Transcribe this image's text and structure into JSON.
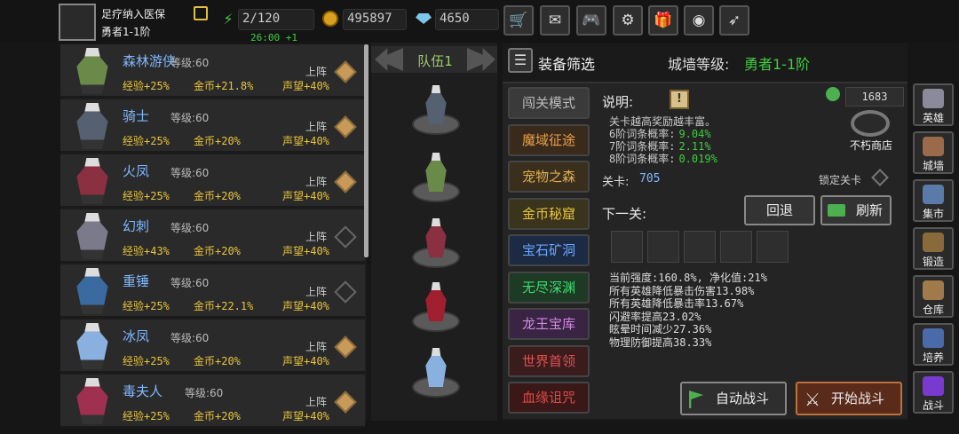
{
  "player": {
    "name": "足疗纳入医保",
    "rank": "勇者1-1阶"
  },
  "resources": {
    "energy": "2/120",
    "energy_timer": "26:00 +1",
    "gold": "495897",
    "gems": "4650"
  },
  "toolbar_icons": [
    "cart-icon",
    "mail-icon",
    "gamepad-icon",
    "gear-icon",
    "gift-icon",
    "wheel-icon",
    "feather-icon"
  ],
  "heroes": [
    {
      "name": "森林游侠",
      "level": "等级:60",
      "action": "上阵",
      "bonus": [
        "经验+25%",
        "金币+21.8%",
        "声望+40%"
      ],
      "deployed": true
    },
    {
      "name": "骑士",
      "level": "等级:60",
      "action": "上阵",
      "bonus": [
        "经验+25%",
        "金币+20%",
        "声望+40%"
      ],
      "deployed": true
    },
    {
      "name": "火凤",
      "level": "等级:60",
      "action": "上阵",
      "bonus": [
        "经验+25%",
        "金币+20%",
        "声望+40%"
      ],
      "deployed": true
    },
    {
      "name": "幻刺",
      "level": "等级:60",
      "action": "上阵",
      "bonus": [
        "经验+43%",
        "金币+20%",
        "声望+40%"
      ],
      "deployed": false
    },
    {
      "name": "重锤",
      "level": "等级:60",
      "action": "上阵",
      "bonus": [
        "经验+25%",
        "金币+22.1%",
        "声望+40%"
      ],
      "deployed": false
    },
    {
      "name": "冰凤",
      "level": "等级:60",
      "action": "上阵",
      "bonus": [
        "经验+25%",
        "金币+20%",
        "声望+40%"
      ],
      "deployed": true
    },
    {
      "name": "毒夫人",
      "level": "等级:60",
      "action": "上阵",
      "bonus": [
        "经验+25%",
        "金币+20%",
        "声望+40%"
      ],
      "deployed": true
    }
  ],
  "team": {
    "label": "队伍1"
  },
  "filter": {
    "label": "装备筛选"
  },
  "wall": {
    "label": "城墙等级:",
    "value": "勇者1-1阶"
  },
  "modes": [
    {
      "label": "闯关模式",
      "color": "#bbbbbb",
      "bg": "#3a3a3a"
    },
    {
      "label": "魔域征途",
      "color": "#e8a04a",
      "bg": "#3a2a1c"
    },
    {
      "label": "宠物之森",
      "color": "#e0b050",
      "bg": "#3a2e1c"
    },
    {
      "label": "金币秘窟",
      "color": "#e8c43c",
      "bg": "#3a341c"
    },
    {
      "label": "宝石矿洞",
      "color": "#6aa8ff",
      "bg": "#1c2a44"
    },
    {
      "label": "无尽深渊",
      "color": "#3fdf6f",
      "bg": "#1c3a24"
    },
    {
      "label": "龙王宝库",
      "color": "#d08ae0",
      "bg": "#3a2444"
    },
    {
      "label": "世界首领",
      "color": "#e05050",
      "bg": "#3a1c1c"
    },
    {
      "label": "血缘诅咒",
      "color": "#e04848",
      "bg": "#3a1818"
    }
  ],
  "description": {
    "label": "说明:",
    "lines": [
      {
        "text": "关卡越高奖励越丰富。",
        "value": ""
      },
      {
        "text": "6阶词条概率:",
        "value": "9.04%"
      },
      {
        "text": "7阶词条概率:",
        "value": "2.11%"
      },
      {
        "text": "8阶词条概率:",
        "value": "0.019%"
      }
    ]
  },
  "shop": {
    "coins": "1683",
    "label": "不朽商店"
  },
  "stage": {
    "label": "关卡:",
    "value": "705",
    "lock_label": "锁定关卡"
  },
  "next": {
    "label": "下一关:",
    "back": "回退",
    "refresh": "刷新"
  },
  "enemy_stats": [
    "当前强度:160.8%, 净化值:21%",
    "所有英雄降低暴击伤害13.98%",
    "所有英雄降低暴击率13.67%",
    "闪避率提高23.02%",
    "眩晕时间减少27.36%",
    "物理防御提高38.33%"
  ],
  "buttons": {
    "auto": "自动战斗",
    "start": "开始战斗"
  },
  "nav": [
    "英雄",
    "城墙",
    "集市",
    "锻造",
    "仓库",
    "培养",
    "战斗"
  ]
}
